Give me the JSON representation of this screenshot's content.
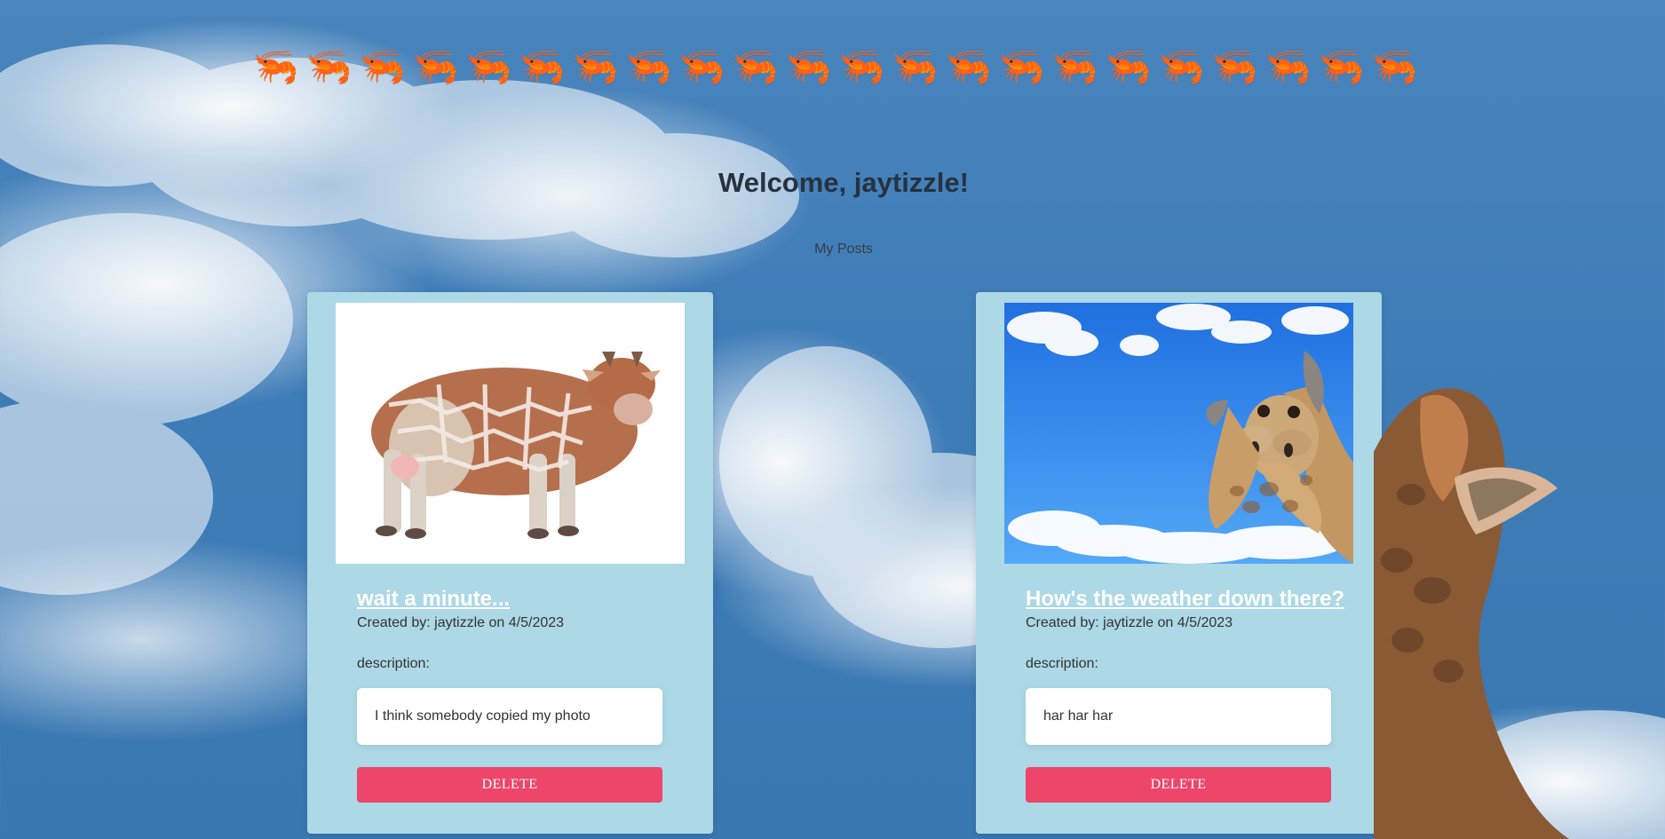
{
  "header": {
    "emoji_row": [
      "🦐",
      "🦐",
      "🦐",
      "🦐",
      "🦐",
      "🦐",
      "🦐",
      "🦐",
      "🦐",
      "🦐",
      "🦐",
      "🦐",
      "🦐",
      "🦐",
      "🦐",
      "🦐",
      "🦐",
      "🦐",
      "🦐",
      "🦐",
      "🦐",
      "🦐"
    ],
    "welcome": "Welcome, jaytizzle!",
    "section_label": "My Posts"
  },
  "posts": [
    {
      "title": "wait a minute...",
      "created": "Created by: jaytizzle on 4/5/2023",
      "description_label": "description:",
      "description": "I think somebody copied my photo",
      "delete_label": "DELETE"
    },
    {
      "title": "How's the weather down there?",
      "created": "Created by: jaytizzle on 4/5/2023",
      "description_label": "description:",
      "description": "har har har",
      "delete_label": "DELETE"
    }
  ],
  "colors": {
    "card_bg": "#add8e6",
    "delete_bg": "#ee456b",
    "title_color": "#ffffff"
  }
}
